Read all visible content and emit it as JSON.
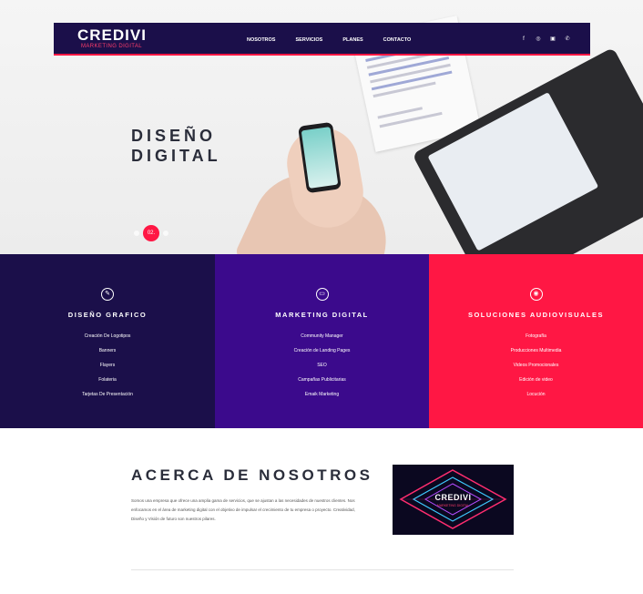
{
  "brand": {
    "name": "CREDIVI",
    "tagline": "MARKETING DIGITAL"
  },
  "nav": {
    "links": [
      "NOSOTROS",
      "SERVICIOS",
      "PLANES",
      "CONTACTO"
    ]
  },
  "social": [
    "facebook-icon",
    "instagram-icon",
    "youtube-icon",
    "whatsapp-icon"
  ],
  "hero": {
    "title": "DISEÑO DIGITAL",
    "slide_indicator": "02."
  },
  "services": [
    {
      "icon": "pencil-icon",
      "title": "DISEÑO GRAFICO",
      "items": [
        "Creación De Logotipos",
        "Banners",
        "Flayers",
        "Folateria",
        "Tarjetas De Presentación"
      ]
    },
    {
      "icon": "monitor-icon",
      "title": "MARKETING DIGITAL",
      "items": [
        "Community Manager",
        "Creación de Landing Pages",
        "SEO",
        "Campañas Publicitarias",
        "Emaik Marketing"
      ]
    },
    {
      "icon": "camera-icon",
      "title": "SOLUCIONES AUDIOVISUALES",
      "items": [
        "Fotografía",
        "Producciones Multimedia",
        "Videos Promocionales",
        "Edición de video",
        "Locución"
      ]
    }
  ],
  "about": {
    "title": "ACERCA DE NOSOTROS",
    "text": "Somos una empresa que ofrece una amplia gama de servicios, que se ajustan a las necesidades de nuestros clientes. Nos enfocamos en el área de marketing digital con el objetivo de impulsar el crecimiento de tu empresa o proyecto. Creatividad, Diseño y Visión de futuro son nuestros pilares.",
    "image": {
      "title": "CREDIVI",
      "subtitle": "MARKETING DIGITAL"
    }
  },
  "colors": {
    "navy": "#1b0f4a",
    "purple": "#3b0a8c",
    "red": "#ff1744"
  }
}
